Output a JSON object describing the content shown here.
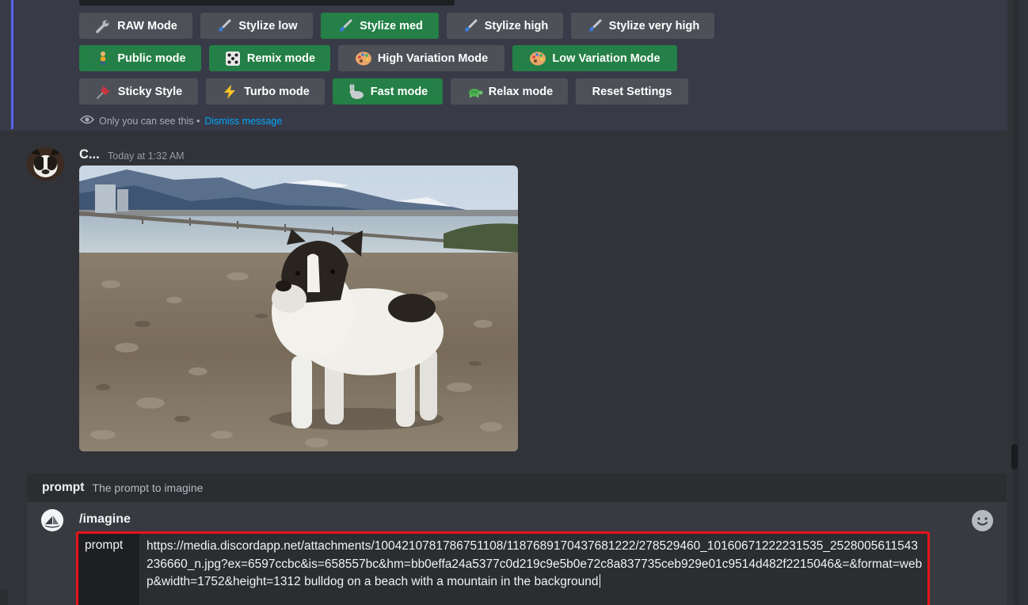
{
  "settings": {
    "buttons": [
      {
        "label": "RAW Mode",
        "icon": "wrench-icon",
        "style": "grey"
      },
      {
        "label": "Stylize low",
        "icon": "paintbrush-icon",
        "style": "grey"
      },
      {
        "label": "Stylize med",
        "icon": "paintbrush-icon",
        "style": "green"
      },
      {
        "label": "Stylize high",
        "icon": "paintbrush-icon",
        "style": "grey"
      },
      {
        "label": "Stylize very high",
        "icon": "paintbrush-icon",
        "style": "grey"
      },
      {
        "label": "Public mode",
        "icon": "person-icon",
        "style": "green"
      },
      {
        "label": "Remix mode",
        "icon": "dice-icon",
        "style": "green"
      },
      {
        "label": "High Variation Mode",
        "icon": "palette-icon",
        "style": "grey"
      },
      {
        "label": "Low Variation Mode",
        "icon": "palette-icon",
        "style": "green"
      },
      {
        "label": "Sticky Style",
        "icon": "pushpin-icon",
        "style": "grey"
      },
      {
        "label": "Turbo mode",
        "icon": "lightning-icon",
        "style": "grey"
      },
      {
        "label": "Fast mode",
        "icon": "rabbit-icon",
        "style": "green"
      },
      {
        "label": "Relax mode",
        "icon": "turtle-icon",
        "style": "grey"
      },
      {
        "label": "Reset Settings",
        "icon": "",
        "style": "grey"
      }
    ],
    "ephemeral_note": "Only you can see this •",
    "dismiss_link": "Dismiss message"
  },
  "message": {
    "author": "C...",
    "timestamp": "Today at 1:32 AM",
    "image_alt": "French bulldog standing on a rocky beach with mountains in the background"
  },
  "command": {
    "hint_name": "prompt",
    "hint_description": "The prompt to imagine",
    "name": "/imagine",
    "option_label": "prompt",
    "option_value": "https://media.discordapp.net/attachments/1004210781786751108/1187689170437681222/278529460_10160671222231535_2528005611543236660_n.jpg?ex=6597ccbc&is=658557bc&hm=bb0effa24a5377c0d219c9e5b0e72c8a837735ceb929e01c9514d482f2215046&=&format=webp&width=1752&height=1312 bulldog on a beach with a mountain in the background"
  },
  "colors": {
    "background": "#313338",
    "panel": "#383a48",
    "button_grey": "#4e5058",
    "button_green": "#248046",
    "link": "#00a8fc",
    "highlight_border": "#e8141c"
  }
}
